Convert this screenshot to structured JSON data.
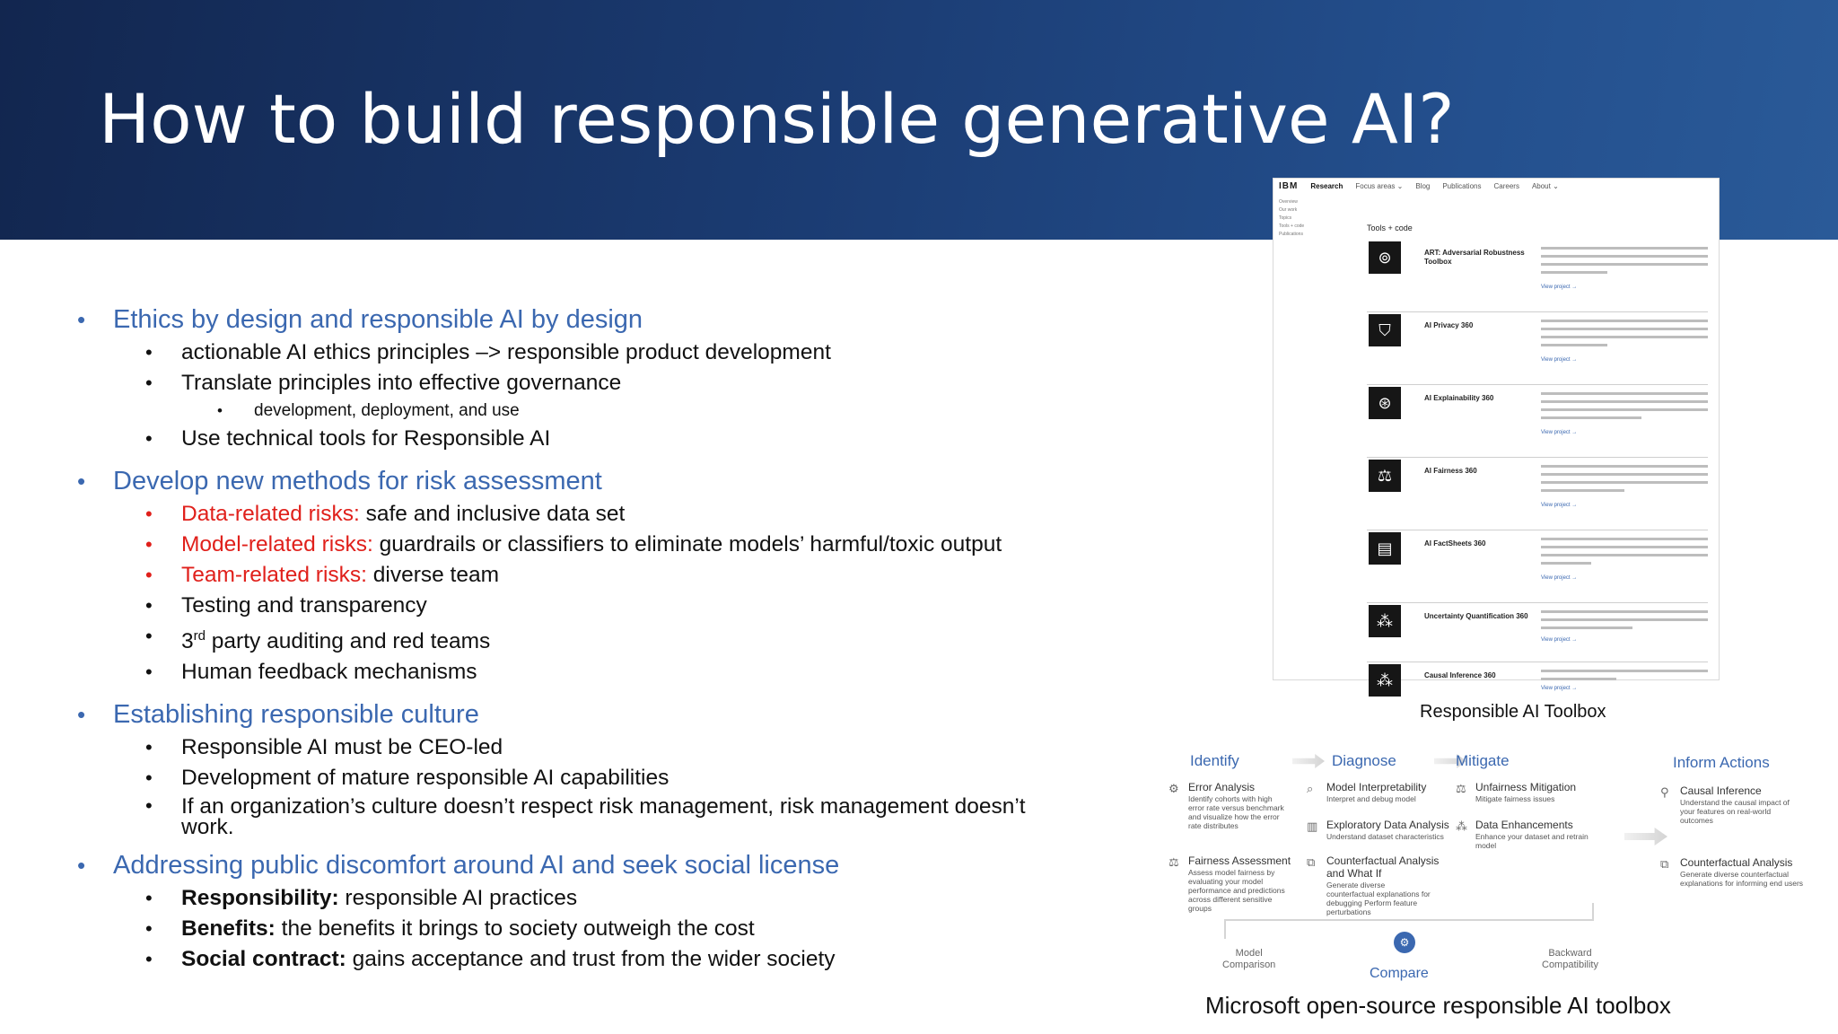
{
  "slide": {
    "title": "How to build responsible generative AI?"
  },
  "bullets": {
    "s1": {
      "heading": "Ethics by design and responsible AI by design",
      "b1": "actionable AI ethics principles –> responsible product development",
      "b2": "Translate principles into effective governance",
      "b2_sub": "development, deployment, and use",
      "b3": "Use technical tools for Responsible AI"
    },
    "s2": {
      "heading": "Develop new methods for risk assessment",
      "r1_label": "Data-related risks:",
      "r1_text": " safe and inclusive data set",
      "r2_label": "Model-related risks:",
      "r2_text": " guardrails or classifiers to eliminate models’ harmful/toxic output",
      "r3_label": "Team-related risks:",
      "r3_text": " diverse team",
      "b4": "Testing and transparency",
      "b5_pre": "3",
      "b5_sup": "rd",
      "b5_post": " party auditing and red teams",
      "b6": "Human feedback mechanisms"
    },
    "s3": {
      "heading": "Establishing responsible culture",
      "b1": "Responsible AI must be CEO-led",
      "b2": "Development of mature responsible AI capabilities",
      "b3_line1": "If an organization’s culture doesn’t respect risk management, risk management doesn’t",
      "b3_line2": "work."
    },
    "s4": {
      "heading": "Addressing public discomfort around AI and seek social license",
      "b1_lead": "Responsibility:",
      "b1_text": "  responsible AI practices",
      "b2_lead": "Benefits:",
      "b2_text": " the benefits it brings to society outweigh the cost",
      "b3_lead": "Social contract:",
      "b3_text": " gains acceptance and trust from the wider society"
    }
  },
  "ibm": {
    "logo": "IBM",
    "nav": [
      "Research",
      "Focus areas ⌄",
      "Blog",
      "Publications",
      "Careers",
      "About ⌄"
    ],
    "side": [
      "Overview",
      "Our work",
      "Topics",
      "Tools + code",
      "Publications"
    ],
    "heading": "Tools + code",
    "link_text": "View project →",
    "tools": [
      {
        "name": "ART: Adversarial Robustness Toolbox",
        "icon": "⊚"
      },
      {
        "name": "AI Privacy 360",
        "icon": "⛉"
      },
      {
        "name": "AI Explainability 360",
        "icon": "⊛"
      },
      {
        "name": "AI Fairness 360",
        "icon": "⚖"
      },
      {
        "name": "AI FactSheets 360",
        "icon": "▤"
      },
      {
        "name": "Uncertainty Quantification 360",
        "icon": "⁂"
      },
      {
        "name": "Causal Inference 360",
        "icon": "⁂"
      }
    ],
    "caption": "Responsible AI Toolbox"
  },
  "ms": {
    "stages": {
      "identify": "Identify",
      "diagnose": "Diagnose",
      "mitigate": "Mitigate",
      "inform": "Inform Actions"
    },
    "items": {
      "error": {
        "title": "Error Analysis",
        "desc": "Identify cohorts with high error rate versus benchmark and visualize how the error rate distributes",
        "icon": "⚙"
      },
      "fairness": {
        "title": "Fairness Assessment",
        "desc": "Assess model fairness by evaluating your model performance and predictions across different sensitive groups",
        "icon": "⚖"
      },
      "interp": {
        "title": "Model Interpretability",
        "desc": "Interpret and debug model",
        "icon": "⌕"
      },
      "eda": {
        "title": "Exploratory Data Analysis",
        "desc": "Understand dataset characteristics",
        "icon": "▥"
      },
      "cf_whatif": {
        "title": "Counterfactual Analysis and What If",
        "desc": "Generate diverse counterfactual explanations for debugging Perform feature perturbations",
        "icon": "⧉"
      },
      "unfair": {
        "title": "Unfairness Mitigation",
        "desc": "Mitigate fairness issues",
        "icon": "⚖"
      },
      "data_enh": {
        "title": "Data Enhancements",
        "desc": "Enhance your dataset and retrain model",
        "icon": "⁂"
      },
      "causal": {
        "title": "Causal Inference",
        "desc": "Understand the causal impact of your features on real-world outcomes",
        "icon": "⚲"
      },
      "cf": {
        "title": "Counterfactual Analysis",
        "desc": "Generate diverse counterfactual explanations for informing end users",
        "icon": "⧉"
      }
    },
    "bottom": {
      "model_comparison_1": "Model",
      "model_comparison_2": "Comparison",
      "backward_1": "Backward",
      "backward_2": "Compatibility",
      "compare": "Compare",
      "compare_icon": "⚙"
    },
    "caption": "Microsoft open-source responsible AI toolbox"
  }
}
